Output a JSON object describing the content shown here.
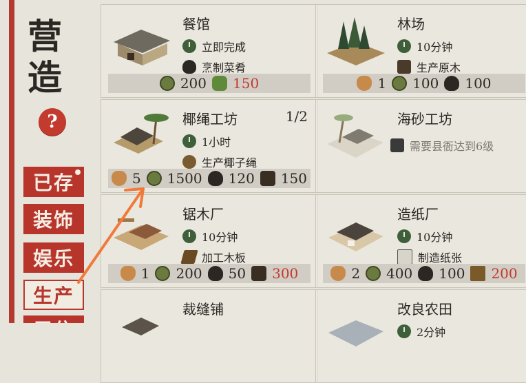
{
  "sidebar": {
    "title_chars": [
      "营",
      "造"
    ],
    "help_label": "?",
    "tabs": [
      {
        "label": "已存",
        "has_dot": true
      },
      {
        "label": "装饰"
      },
      {
        "label": "娱乐"
      },
      {
        "label": "生产",
        "active": true
      },
      {
        "label": "居住"
      }
    ]
  },
  "buildings": [
    {
      "name": "餐馆",
      "time": "立即完成",
      "product": "烹制菜肴",
      "costs": [
        {
          "icon": "coin",
          "value": "200"
        },
        {
          "icon": "veg",
          "value": "150",
          "insufficient": true
        }
      ]
    },
    {
      "name": "林场",
      "time": "10分钟",
      "product": "生产原木",
      "costs": [
        {
          "icon": "worker",
          "value": "1"
        },
        {
          "icon": "coin",
          "value": "100"
        },
        {
          "icon": "bowl",
          "value": "100"
        }
      ]
    },
    {
      "name": "椰绳工坊",
      "count": "1/2",
      "time": "1小时",
      "product": "生产椰子绳",
      "costs": [
        {
          "icon": "worker",
          "value": "5"
        },
        {
          "icon": "coin",
          "value": "1500"
        },
        {
          "icon": "bowl",
          "value": "120"
        },
        {
          "icon": "wood",
          "value": "150"
        }
      ]
    },
    {
      "name": "海砂工坊",
      "locked_text": "需要县衙达到6级"
    },
    {
      "name": "锯木厂",
      "time": "10分钟",
      "product": "加工木板",
      "costs": [
        {
          "icon": "worker",
          "value": "1"
        },
        {
          "icon": "coin",
          "value": "200"
        },
        {
          "icon": "bowl",
          "value": "50"
        },
        {
          "icon": "wood",
          "value": "300",
          "insufficient": true
        }
      ]
    },
    {
      "name": "造纸厂",
      "time": "10分钟",
      "product": "制造纸张",
      "costs": [
        {
          "icon": "worker",
          "value": "2"
        },
        {
          "icon": "coin",
          "value": "400"
        },
        {
          "icon": "bowl",
          "value": "100"
        },
        {
          "icon": "board",
          "value": "200",
          "insufficient": true
        }
      ]
    },
    {
      "name": "裁缝铺"
    },
    {
      "name": "改良农田",
      "time": "2分钟"
    }
  ],
  "colors": {
    "accent_red": "#b8352b",
    "insufficient": "#c13a30",
    "background": "#e7e4dc"
  }
}
